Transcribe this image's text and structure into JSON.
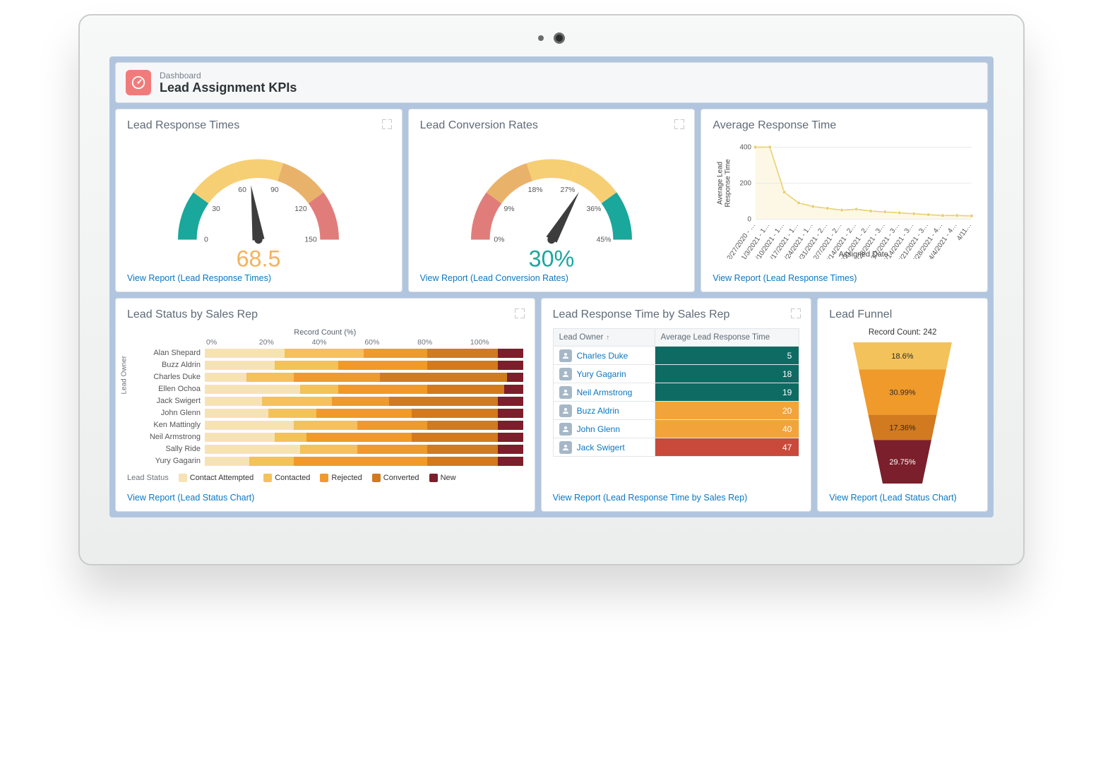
{
  "header": {
    "eyebrow": "Dashboard",
    "title": "Lead Assignment KPIs"
  },
  "cards": {
    "responseTimes": {
      "title": "Lead Response Times",
      "value": "68.5",
      "link": "View Report (Lead Response Times)"
    },
    "conversionRates": {
      "title": "Lead Conversion Rates",
      "value": "30%",
      "link": "View Report (Lead Conversion Rates)"
    },
    "avgResponse": {
      "title": "Average Response Time",
      "yTitle": "Average Lead\nResponse Time",
      "xTitle": "Assigned Date",
      "link": "View Report (Lead Response Times)"
    },
    "statusByRep": {
      "title": "Lead Status by Sales Rep",
      "axisTitle": "Record Count (%)",
      "yTitle": "Lead Owner",
      "legendLabel": "Lead Status",
      "link": "View Report (Lead Status Chart)"
    },
    "responseByRep": {
      "title": "Lead Response Time by Sales Rep",
      "col1": "Lead Owner",
      "col2": "Average Lead Response Time",
      "link": "View Report (Lead Response Time by Sales Rep)"
    },
    "funnel": {
      "title": "Lead Funnel",
      "countLabel": "Record Count: 242",
      "link": "View Report (Lead Status Chart)"
    }
  },
  "chart_data": [
    {
      "id": "lead_response_times_gauge",
      "type": "gauge",
      "title": "Lead Response Times",
      "value": 68.5,
      "min": 0,
      "max": 150,
      "ticks": [
        0,
        30,
        60,
        90,
        120,
        150
      ],
      "bands": [
        {
          "from": 0,
          "to": 30,
          "color": "#1aa79c"
        },
        {
          "from": 30,
          "to": 60,
          "color": "#f6cf74"
        },
        {
          "from": 60,
          "to": 90,
          "color": "#f6cf74"
        },
        {
          "from": 90,
          "to": 120,
          "color": "#e9b26a"
        },
        {
          "from": 120,
          "to": 150,
          "color": "#e07d7a"
        }
      ],
      "value_color": "#f5b25a"
    },
    {
      "id": "lead_conversion_rates_gauge",
      "type": "gauge",
      "title": "Lead Conversion Rates",
      "value": 30,
      "unit": "%",
      "min": 0,
      "max": 45,
      "ticks": [
        0,
        9,
        18,
        27,
        36,
        45
      ],
      "tick_suffix": "%",
      "bands": [
        {
          "from": 0,
          "to": 9,
          "color": "#e07d7a"
        },
        {
          "from": 9,
          "to": 18,
          "color": "#e9b26a"
        },
        {
          "from": 18,
          "to": 27,
          "color": "#f6cf74"
        },
        {
          "from": 27,
          "to": 36,
          "color": "#f6cf74"
        },
        {
          "from": 36,
          "to": 45,
          "color": "#1aa79c"
        }
      ],
      "value_color": "#1aa79c"
    },
    {
      "id": "avg_response_time_line",
      "type": "line",
      "title": "Average Response Time",
      "xlabel": "Assigned Date",
      "ylabel": "Average Lead Response Time",
      "ylim": [
        0,
        400
      ],
      "yticks": [
        0,
        200,
        400
      ],
      "categories": [
        "12/27/2020 - …",
        "1/3/2021 - 1…",
        "1/10/2021 - 1…",
        "1/17/2021 - 1…",
        "1/24/2021 - 1…",
        "1/31/2021 - 2…",
        "2/7/2021 - 2…",
        "2/14/2021 - 2…",
        "2/21/2021 - 2…",
        "2/28/2021 - 3…",
        "3/7/2021 - 3…",
        "3/14/2021 - 3…",
        "3/21/2021 - 3…",
        "3/28/2021 - 4…",
        "4/4/2021 - 4…",
        "4/11…"
      ],
      "values": [
        400,
        400,
        150,
        90,
        70,
        60,
        50,
        55,
        45,
        40,
        35,
        30,
        25,
        20,
        20,
        18
      ],
      "color": "#e9cf6d"
    },
    {
      "id": "lead_status_by_rep_stacked",
      "type": "bar",
      "subtype": "stacked_100pct_horizontal",
      "title": "Lead Status by Sales Rep",
      "xlabel": "Record Count (%)",
      "ylabel": "Lead Owner",
      "xticks": [
        0,
        20,
        40,
        60,
        80,
        100
      ],
      "categories": [
        "Alan Shepard",
        "Buzz Aldrin",
        "Charles Duke",
        "Ellen Ochoa",
        "Jack Swigert",
        "John Glenn",
        "Ken Mattingly",
        "Neil Armstrong",
        "Sally Ride",
        "Yury Gagarin"
      ],
      "series": [
        {
          "name": "Contact Attempted",
          "color": "#f6e3b5",
          "values": [
            25,
            22,
            13,
            30,
            18,
            20,
            28,
            22,
            30,
            14
          ]
        },
        {
          "name": "Contacted",
          "color": "#f3c25a",
          "values": [
            25,
            20,
            15,
            12,
            22,
            15,
            20,
            10,
            18,
            14
          ]
        },
        {
          "name": "Rejected",
          "color": "#f09a2b",
          "values": [
            20,
            28,
            27,
            28,
            18,
            30,
            22,
            33,
            22,
            42
          ]
        },
        {
          "name": "Converted",
          "color": "#d17a1f",
          "values": [
            22,
            22,
            40,
            24,
            34,
            27,
            22,
            27,
            22,
            22
          ]
        },
        {
          "name": "New",
          "color": "#7a1f2b",
          "values": [
            8,
            8,
            5,
            6,
            8,
            8,
            8,
            8,
            8,
            8
          ]
        }
      ]
    },
    {
      "id": "lead_response_by_rep_table",
      "type": "table",
      "title": "Lead Response Time by Sales Rep",
      "columns": [
        "Lead Owner",
        "Average Lead Response Time"
      ],
      "sort": {
        "column": "Lead Owner",
        "dir": "asc"
      },
      "rows": [
        {
          "owner": "Charles Duke",
          "value": 5,
          "color": "#0e6b63"
        },
        {
          "owner": "Yury Gagarin",
          "value": 18,
          "color": "#0e6b63"
        },
        {
          "owner": "Neil Armstrong",
          "value": 19,
          "color": "#0e6b63"
        },
        {
          "owner": "Buzz Aldrin",
          "value": 20,
          "color": "#f2a43a"
        },
        {
          "owner": "John Glenn",
          "value": 40,
          "color": "#f2a43a"
        },
        {
          "owner": "Jack Swigert",
          "value": 47,
          "color": "#c94a3b"
        }
      ]
    },
    {
      "id": "lead_funnel",
      "type": "funnel",
      "title": "Lead Funnel",
      "total_label": "Record Count: 242",
      "stages": [
        {
          "label": "18.6%",
          "value": 18.6,
          "color": "#f3c25a"
        },
        {
          "label": "30.99%",
          "value": 30.99,
          "color": "#f09a2b"
        },
        {
          "label": "17.36%",
          "value": 17.36,
          "color": "#d17a1f"
        },
        {
          "label": "29.75%",
          "value": 29.75,
          "color": "#7a1f2b",
          "text_color": "light"
        }
      ]
    }
  ]
}
